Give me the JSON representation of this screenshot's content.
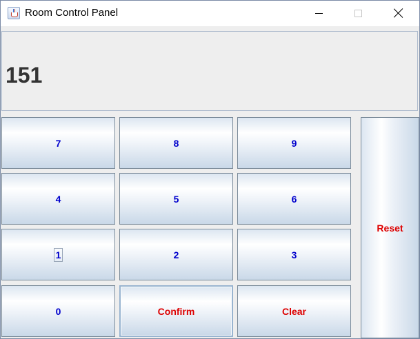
{
  "window": {
    "title": "Room Control Panel",
    "icon": "java-cup-icon",
    "controls": [
      "minimize-icon",
      "maximize-icon",
      "close-icon"
    ]
  },
  "display": {
    "value": "151"
  },
  "keypad": {
    "key_7": "7",
    "key_8": "8",
    "key_9": "9",
    "key_4": "4",
    "key_5": "5",
    "key_6": "6",
    "key_1": "1",
    "key_2": "2",
    "key_3": "3",
    "key_0": "0",
    "confirm": "Confirm",
    "clear": "Clear",
    "reset": "Reset"
  },
  "colors": {
    "digit_text": "#0000cc",
    "action_text": "#dd0000",
    "display_text": "#333333"
  }
}
